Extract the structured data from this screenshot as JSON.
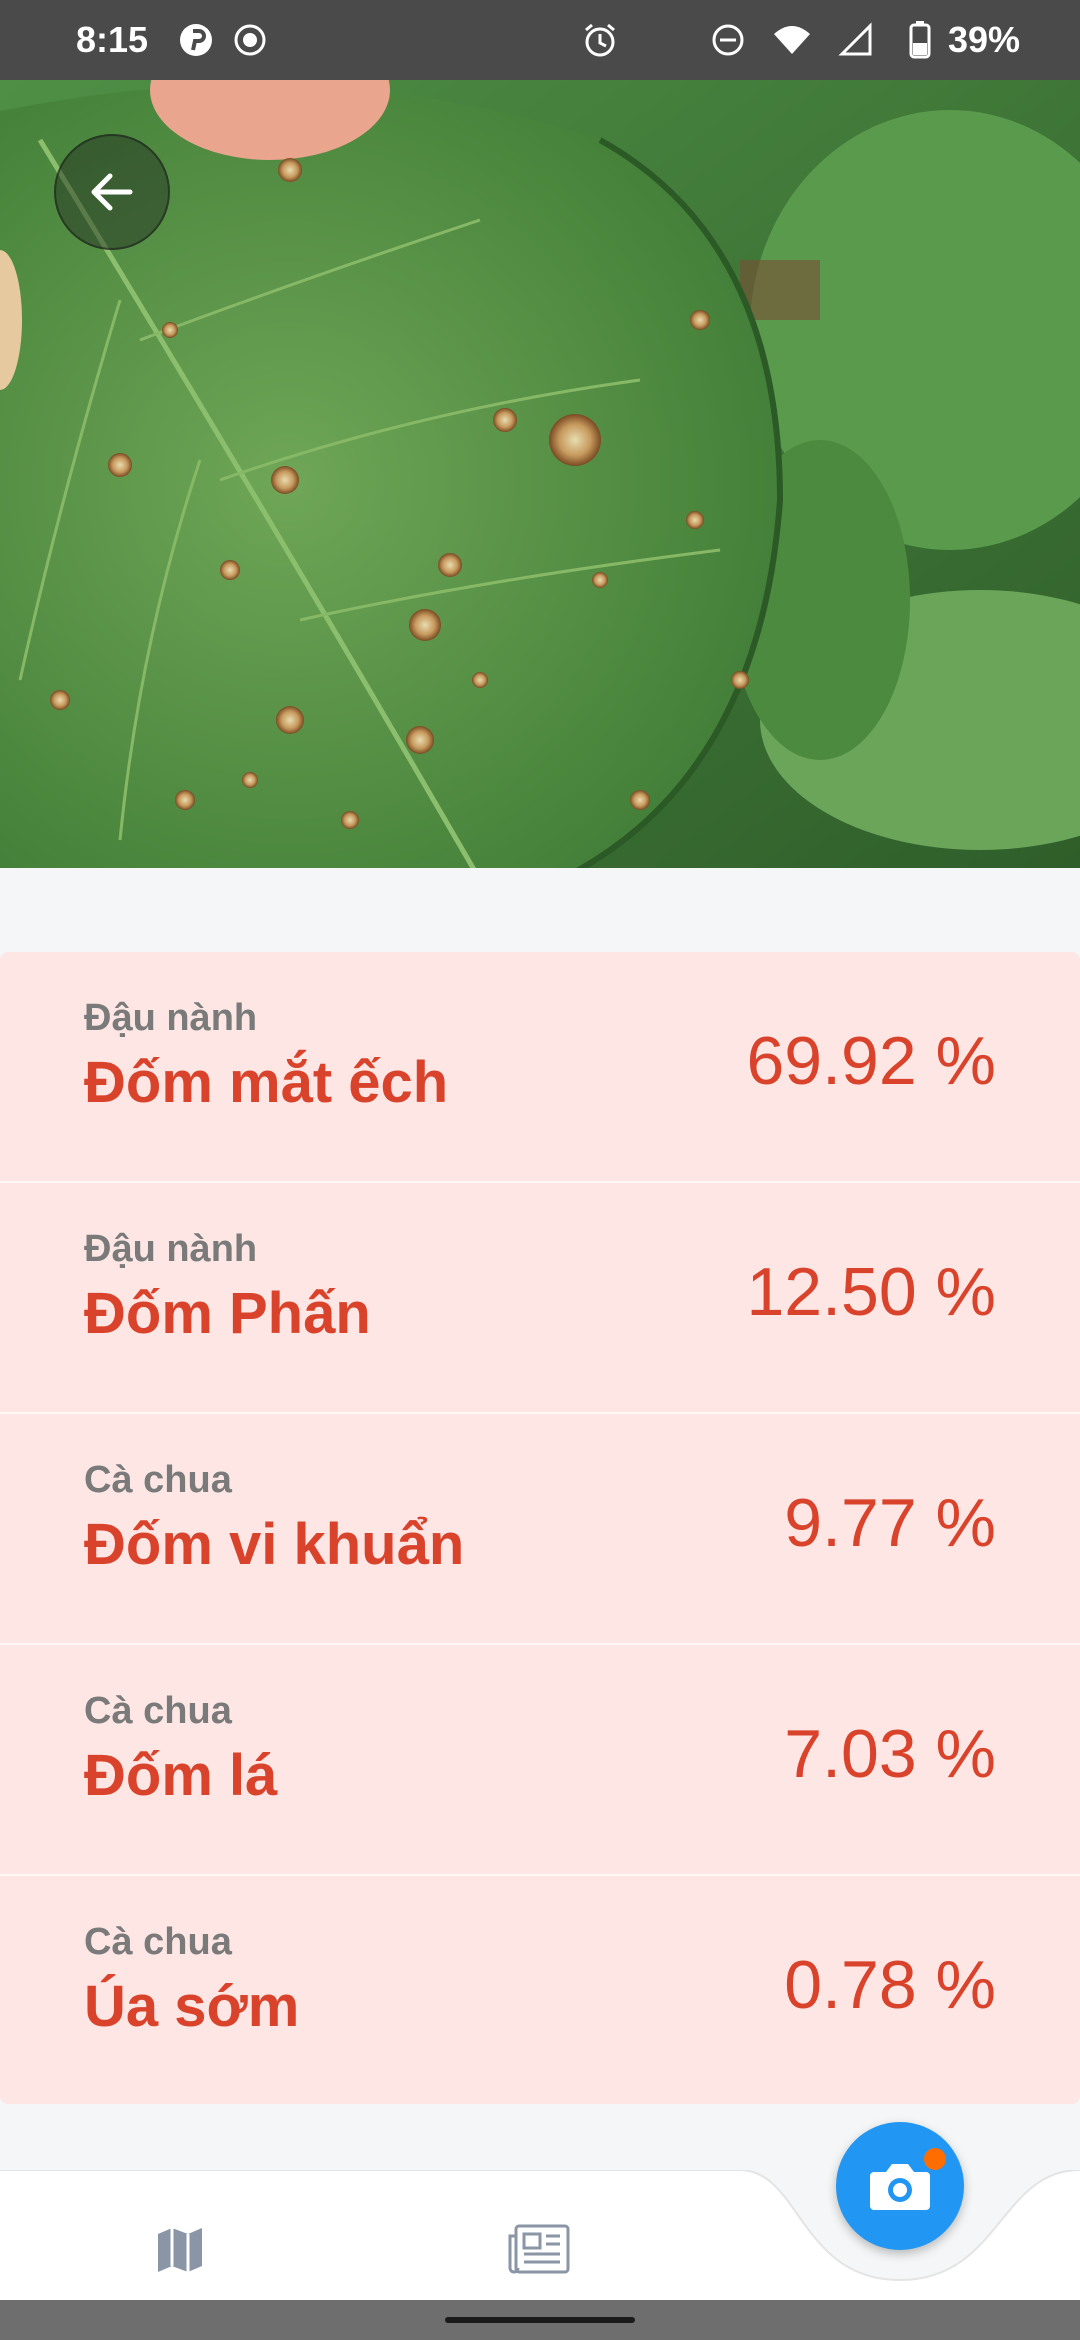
{
  "status_bar": {
    "time": "8:15",
    "battery_percent": "39%",
    "icons": [
      "pinterest-icon",
      "record-icon",
      "alarm-icon",
      "do-not-disturb-icon",
      "wifi-icon",
      "signal-icon",
      "battery-icon"
    ]
  },
  "hero": {
    "image_subject": "soybean leaf with frogeye leaf spots"
  },
  "results": [
    {
      "crop": "Đậu nành",
      "disease": "Đốm mắt ếch",
      "percent": "69.92 %"
    },
    {
      "crop": "Đậu nành",
      "disease": "Đốm Phấn",
      "percent": "12.50 %"
    },
    {
      "crop": "Cà chua",
      "disease": "Đốm vi khuẩn",
      "percent": "9.77 %"
    },
    {
      "crop": "Cà chua",
      "disease": "Đốm lá",
      "percent": "7.03 %"
    },
    {
      "crop": "Cà chua",
      "disease": "Úa sớm",
      "percent": "0.78 %"
    }
  ],
  "bottom_nav": {
    "items": [
      "map-icon",
      "news-icon"
    ],
    "fab_icon": "camera-icon"
  },
  "colors": {
    "accent": "#d9432b",
    "results_bg": "#fde6e4",
    "fab": "#2196f3",
    "fab_badge": "#ff6d00",
    "status_bar": "#4a4a4a"
  }
}
